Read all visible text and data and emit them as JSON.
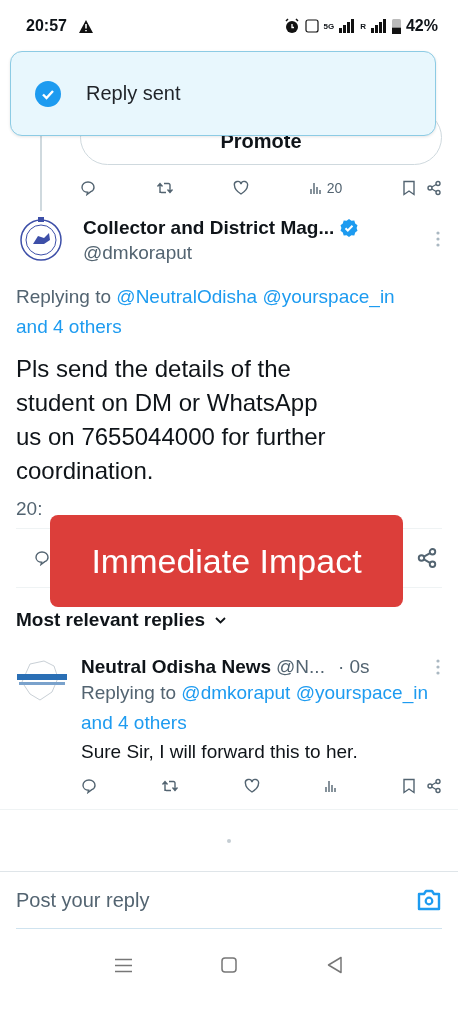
{
  "status_bar": {
    "time": "20:57",
    "network_5g": "5G",
    "roaming": "R",
    "battery": "42%"
  },
  "toast": {
    "text": "Reply sent"
  },
  "previous_tweet": {
    "button": "Promote",
    "views": "20"
  },
  "tweet": {
    "name": "Collector and District Mag...",
    "handle": "@dmkoraput",
    "verified": true,
    "replying_prefix": "Replying to",
    "mentions": [
      "@NeutralOdisha",
      "@yourspace_in"
    ],
    "others": "and 4 others",
    "body": "Pls send the details of the\nstudent on DM or WhatsApp\nus on 7655044000 for further\ncoordination.",
    "timestamp": "20:"
  },
  "overlay_banner": {
    "text": "Immediate Impact"
  },
  "replies_header": {
    "label": "Most relevant replies"
  },
  "replies": [
    {
      "name": "Neutral Odisha News",
      "handle": "@N...",
      "time": "· 0s",
      "replying_prefix": "Replying to",
      "mentions": [
        "@dmkoraput",
        "@yourspace_in"
      ],
      "others": "and 4 others",
      "text": "Sure Sir, I will forward this to her."
    }
  ],
  "composer": {
    "placeholder": "Post your reply"
  }
}
